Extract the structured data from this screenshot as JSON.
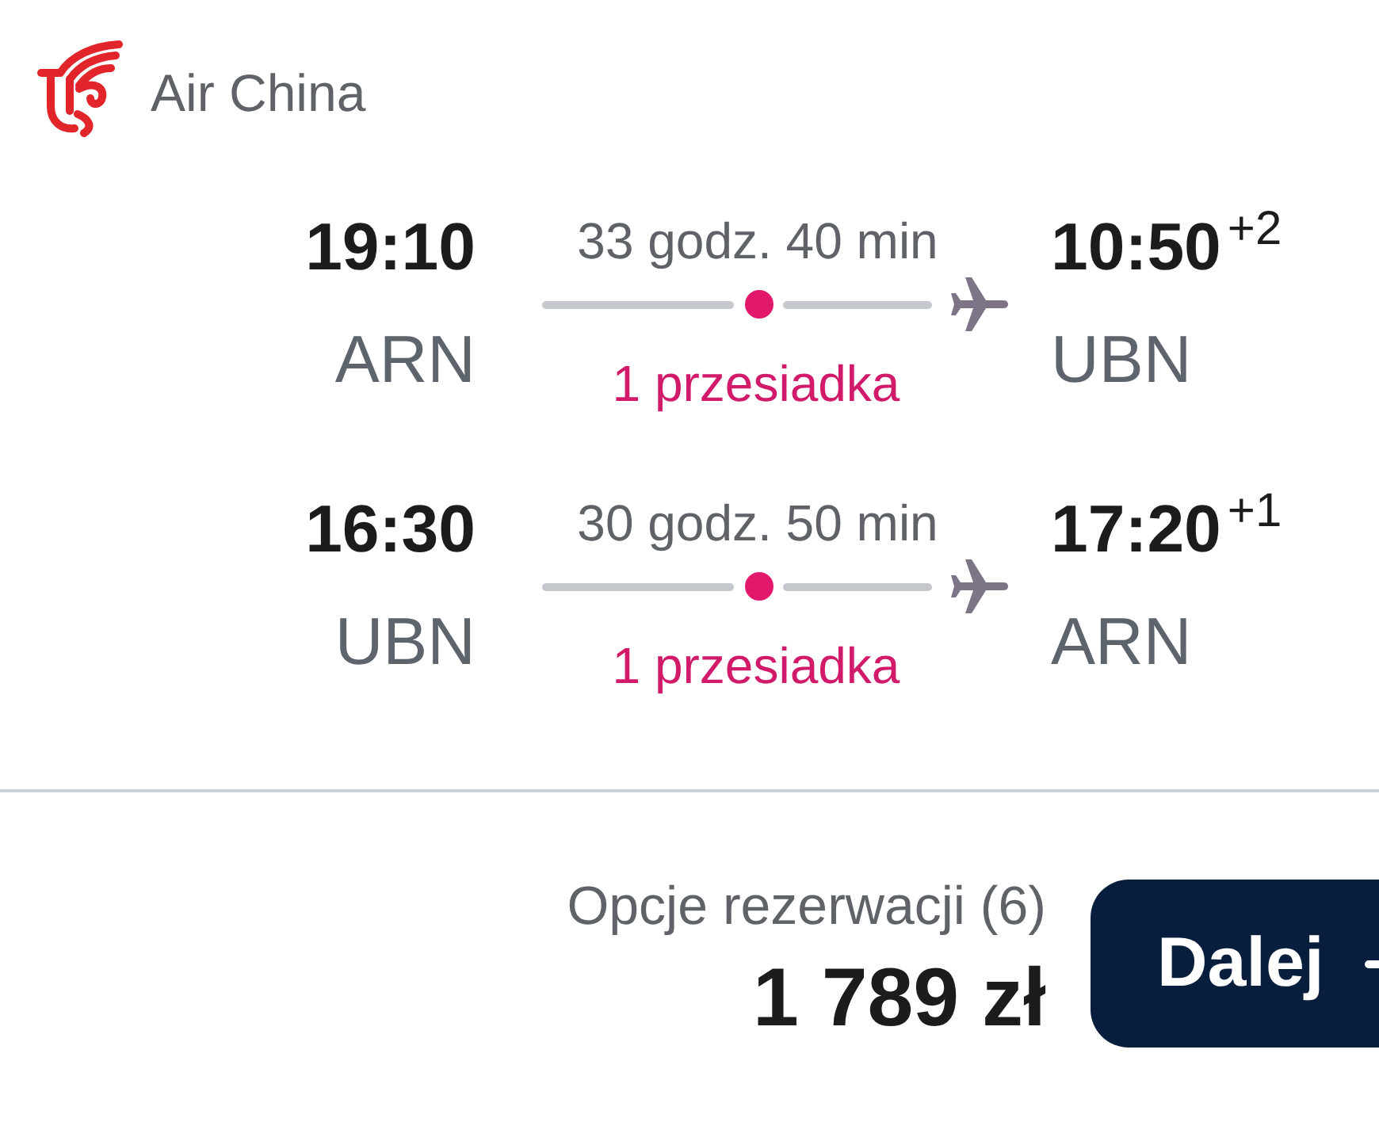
{
  "airline": {
    "name": "Air China"
  },
  "legs": [
    {
      "depart_time": "19:10",
      "depart_airport": "ARN",
      "duration": "33 godz. 40 min",
      "stops": "1 przesiadka",
      "arrive_time": "10:50",
      "day_offset": "+2",
      "arrive_airport": "UBN"
    },
    {
      "depart_time": "16:30",
      "depart_airport": "UBN",
      "duration": "30 godz. 50 min",
      "stops": "1 przesiadka",
      "arrive_time": "17:20",
      "day_offset": "+1",
      "arrive_airport": "ARN"
    }
  ],
  "booking": {
    "options_label": "Opcje rezerwacji (6)",
    "price": "1 789 zł",
    "continue_button": "Dalej"
  }
}
